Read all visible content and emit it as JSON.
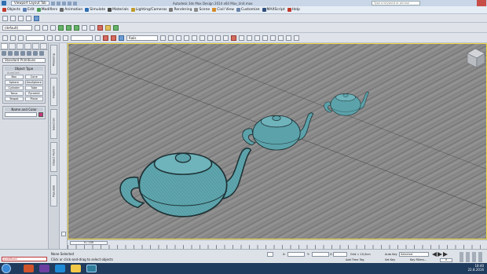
{
  "window": {
    "layout_menu": "Viewport Layout Tab",
    "title": "Autodesk 3ds Max Design 2014 x64    Max_Unit.max",
    "search_placeholder": "Type a keyword or phrase"
  },
  "menubar": {
    "items": [
      {
        "label": "Objects",
        "icon": "objects-icon",
        "color": "#c23a2e"
      },
      {
        "label": "Edit",
        "icon": "edit-icon",
        "color": "#5d7fb5"
      },
      {
        "label": "Modifiers",
        "icon": "modifiers-icon",
        "color": "#4b9a54"
      },
      {
        "label": "Animation",
        "icon": "animation-icon",
        "color": "#6a6a6a"
      },
      {
        "label": "Simulate",
        "icon": "simulate-icon",
        "color": "#2f6fb1"
      },
      {
        "label": "Materials",
        "icon": "materials-icon",
        "color": "#4a4a4a"
      },
      {
        "label": "Lighting/Cameras",
        "icon": "lighting-icon",
        "color": "#c09b2c"
      },
      {
        "label": "Rendering",
        "icon": "rendering-icon",
        "color": "#7a7a7a"
      },
      {
        "label": "Scene",
        "icon": "scene-icon",
        "color": "#8c8c8c"
      },
      {
        "label": "Civil View",
        "icon": "civil-view-icon",
        "color": "#d48a2a"
      },
      {
        "label": "Customize",
        "icon": "customize-icon",
        "color": "#6a85a8"
      },
      {
        "label": "MAXScript",
        "icon": "maxscript-icon",
        "color": "#2f4f7f"
      },
      {
        "label": "Help",
        "icon": "help-icon",
        "color": "#c0392b"
      }
    ]
  },
  "toolbar": {
    "selection_set": "(default)",
    "named_selection": "Rails"
  },
  "command_panel": {
    "category": "Standard Primitives",
    "object_type_title": "Object Type",
    "autogrid_label": "AutoGrid",
    "buttons": [
      "Box",
      "Cone",
      "Sphere",
      "GeoSphere",
      "Cylinder",
      "Tube",
      "Torus",
      "Pyramid",
      "Teapot",
      "Plane"
    ],
    "name_color_title": "Name and Color"
  },
  "side_tabs": [
    "Modeling",
    "Freeform",
    "Selection",
    "Object Paint",
    "Populate"
  ],
  "timeline": {
    "slider_label": "0 / 100"
  },
  "status": {
    "maxscript": "undefined",
    "selection": "None Selected",
    "prompt": "Click or click-and-drag to select objects",
    "x_label": "X:",
    "y_label": "Y:",
    "z_label": "Z:",
    "grid": "Grid = 10,0cm",
    "add_time_tag": "Add Time Tag",
    "auto_key": "Auto Key",
    "set_key": "Set Key",
    "selected_dropdown": "Selected",
    "key_filters": "Key Filters...",
    "frame": "0"
  },
  "taskbar": {
    "time": "18:40",
    "date": "22.8.2016"
  },
  "scene": {
    "viewport_background": "#8a8a8a",
    "teapot_color": "#5fa6ae",
    "outline_color": "#1d3134"
  }
}
